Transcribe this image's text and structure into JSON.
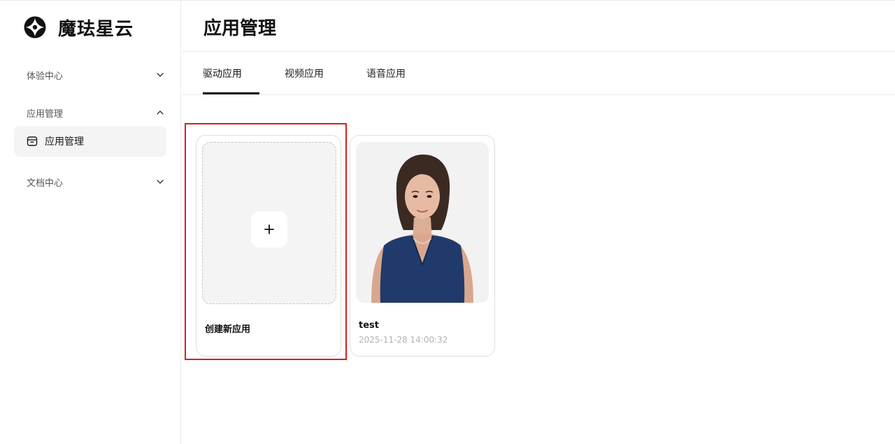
{
  "brand": {
    "name": "魔珐星云",
    "logo_icon": "brand-logo-icon"
  },
  "sidebar": {
    "groups": [
      {
        "label": "体验中心",
        "expanded": false
      },
      {
        "label": "应用管理",
        "expanded": true,
        "items": [
          {
            "label": "应用管理",
            "icon": "archive-box-icon",
            "active": true
          }
        ]
      },
      {
        "label": "文档中心",
        "expanded": false
      }
    ]
  },
  "header": {
    "title": "应用管理"
  },
  "tabs": [
    {
      "label": "驱动应用",
      "active": true
    },
    {
      "label": "视频应用",
      "active": false
    },
    {
      "label": "语音应用",
      "active": false
    }
  ],
  "cards": {
    "create": {
      "label": "创建新应用",
      "icon": "plus-icon"
    },
    "apps": [
      {
        "name": "test",
        "created": "2025-11-28 14:00:32"
      }
    ]
  },
  "colors": {
    "highlight": "#d81e1e",
    "active_bg": "#f4f4f4",
    "text_muted": "#b3b3b3"
  }
}
